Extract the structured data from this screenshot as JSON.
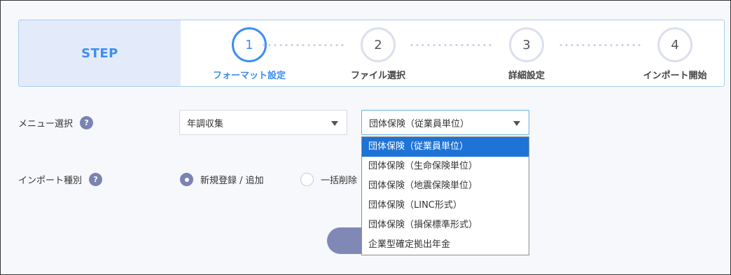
{
  "steps": {
    "header": "STEP",
    "items": [
      {
        "number": "1",
        "label": "フォーマット設定"
      },
      {
        "number": "2",
        "label": "ファイル選択"
      },
      {
        "number": "3",
        "label": "詳細設定"
      },
      {
        "number": "4",
        "label": "インポート開始"
      }
    ]
  },
  "menu_select": {
    "label": "メニュー選択",
    "help": "?",
    "primary_value": "年調収集",
    "secondary_value": "団体保険（従業員単位）",
    "options": [
      "団体保険（従業員単位）",
      "団体保険（生命保険単位）",
      "団体保険（地震保険単位）",
      "団体保険（LINC形式）",
      "団体保険（損保標準形式）",
      "企業型確定拠出年金"
    ]
  },
  "import_type": {
    "label": "インポート種別",
    "help": "?",
    "options": [
      "新規登録 / 追加",
      "一括削除"
    ]
  },
  "colors": {
    "accent": "#3d8ef0",
    "badge": "#7983b4",
    "selected_option": "#1e73d6"
  }
}
